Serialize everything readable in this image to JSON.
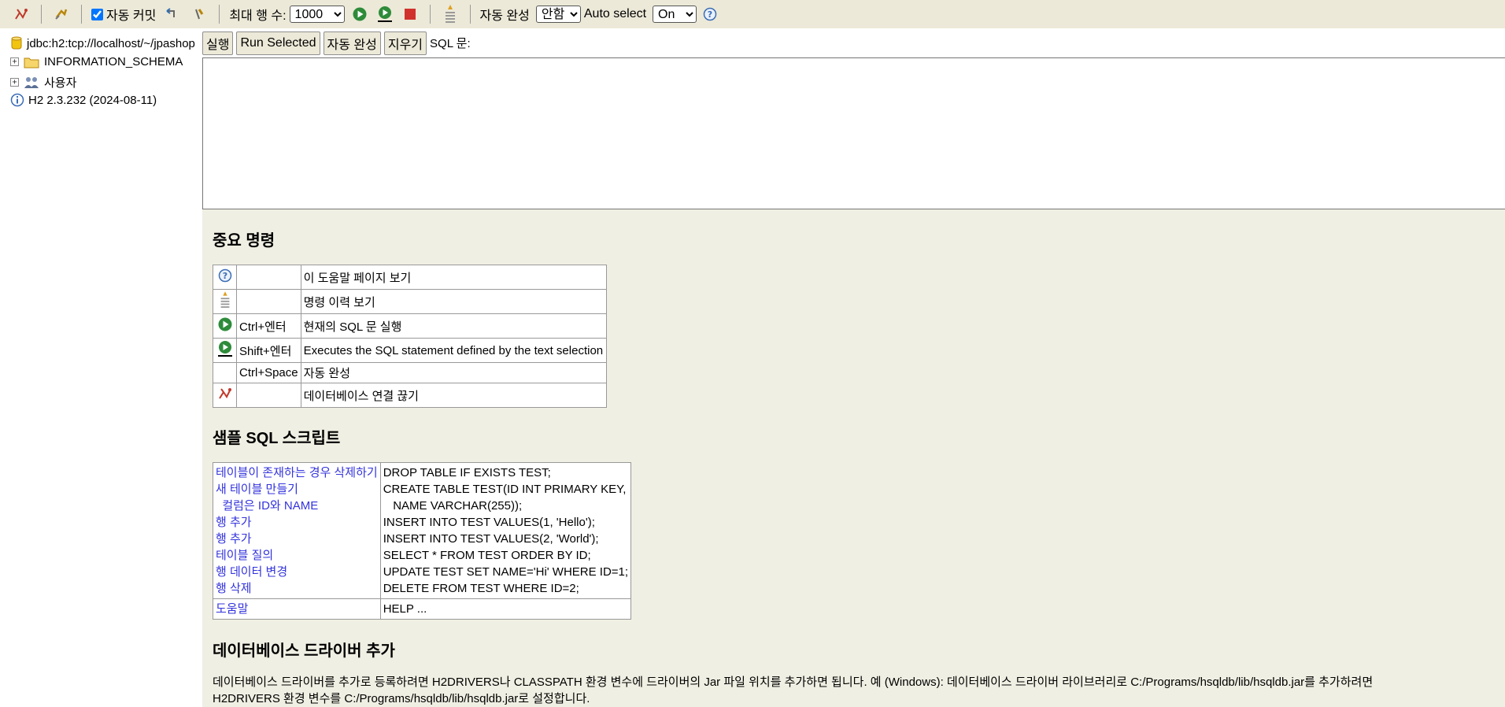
{
  "toolbar": {
    "autocommit_label": "자동 커밋",
    "max_rows_label": "최대 행 수:",
    "max_rows_value": "1000",
    "max_rows_options": [
      "1000"
    ],
    "autocomplete_label": "자동 완성",
    "autocomplete_value": "안함",
    "autoselect_label": "Auto select",
    "autoselect_value": "On",
    "icons": [
      "disconnect-icon",
      "refresh-icon",
      "rollback-icon",
      "commit-icon",
      "run-icon",
      "run-selected-icon",
      "stop-icon",
      "history-icon",
      "help-icon"
    ]
  },
  "sidebar": {
    "connection": "jdbc:h2:tcp://localhost/~/jpashop",
    "items": [
      {
        "label": "INFORMATION_SCHEMA",
        "icon": "folder-icon"
      },
      {
        "label": "사용자",
        "icon": "users-icon"
      }
    ],
    "version": "H2 2.3.232 (2024-08-11)"
  },
  "cmdbar": {
    "run": "실행",
    "run_selected": "Run Selected",
    "autocomplete": "자동 완성",
    "clear": "지우기",
    "sql_label": "SQL 문:"
  },
  "help": {
    "important_title": "중요 명령",
    "commands": [
      {
        "icon": "help-icon",
        "key": "",
        "desc": "이 도움말 페이지 보기"
      },
      {
        "icon": "history-icon",
        "key": "",
        "desc": "명령 이력 보기"
      },
      {
        "icon": "run-icon",
        "key": "Ctrl+엔터",
        "desc": "현재의 SQL 문 실행"
      },
      {
        "icon": "run-selected-icon",
        "key": "Shift+엔터",
        "desc": "Executes the SQL statement defined by the text selection"
      },
      {
        "icon": "",
        "key": "Ctrl+Space",
        "desc": "자동 완성"
      },
      {
        "icon": "disconnect-icon",
        "key": "",
        "desc": "데이터베이스 연결 끊기"
      }
    ],
    "sample_title": "샘플 SQL 스크립트",
    "sample_labels": [
      "테이블이 존재하는 경우 삭제하기",
      "새 테이블 만들기",
      "  컬럼은 ID와 NAME",
      "행 추가",
      "행 추가",
      "테이블 질의",
      "행 데이터 변경",
      "행 삭제"
    ],
    "sample_sql": [
      "DROP TABLE IF EXISTS TEST;",
      "CREATE TABLE TEST(ID INT PRIMARY KEY,",
      "   NAME VARCHAR(255));",
      "INSERT INTO TEST VALUES(1, 'Hello');",
      "INSERT INTO TEST VALUES(2, 'World');",
      "SELECT * FROM TEST ORDER BY ID;",
      "UPDATE TEST SET NAME='Hi' WHERE ID=1;",
      "DELETE FROM TEST WHERE ID=2;"
    ],
    "help_label": "도움말",
    "help_sql": "HELP ...",
    "driver_title": "데이터베이스 드라이버 추가",
    "driver_text_1": "데이터베이스 드라이버를 추가로 등록하려면 H2DRIVERS나 CLASSPATH 환경 변수에 드라이버의 Jar 파일 위치를 추가하면 됩니다. 예 (Windows): 데이터베이스 드라이버 라이브러리로 C:/Programs/hsqldb/lib/hsqldb.jar를 추가하려면",
    "driver_text_2": "H2DRIVERS 환경 변수를 C:/Programs/hsqldb/lib/hsqldb.jar로 설정합니다."
  }
}
